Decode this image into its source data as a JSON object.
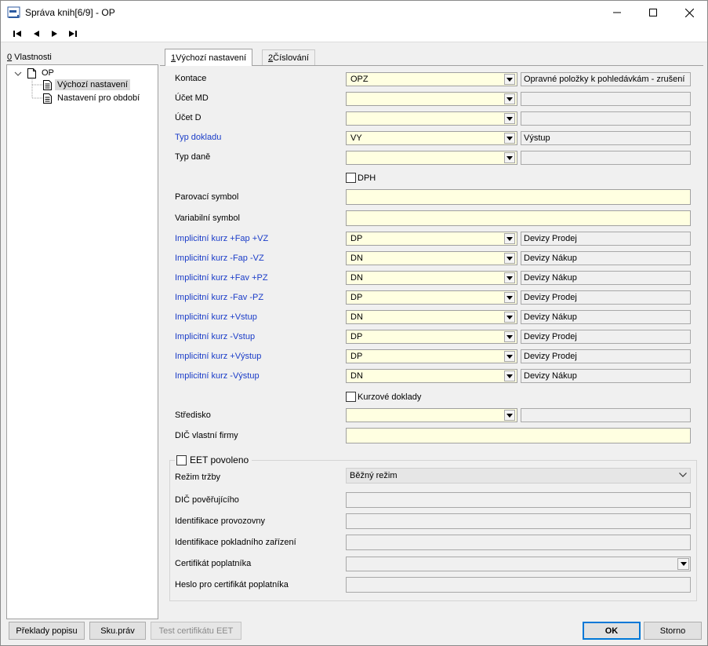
{
  "window": {
    "title": "Správa knih[6/9] - OP",
    "minimize_glyph": "—",
    "maximize_glyph": "☐",
    "close_glyph": "✕"
  },
  "toolbar": {
    "buttons": [
      "first-record-icon",
      "previous-record-icon",
      "next-record-icon",
      "last-record-icon"
    ]
  },
  "tree": {
    "caption_mnemonic": "0",
    "caption_rest": " Vlastnosti",
    "root": "OP",
    "items": [
      "Výchozí nastavení",
      "Nastavení pro období"
    ],
    "selected_index": 0
  },
  "tabs": [
    {
      "mnemonic": "1",
      "label": " Výchozí nastavení",
      "active": true
    },
    {
      "mnemonic": "2",
      "label": " Číslování",
      "active": false
    }
  ],
  "form": {
    "kontace": {
      "label": "Kontace",
      "value": "OPZ",
      "desc": "Opravné položky k pohledávkám - zrušení"
    },
    "ucet_md": {
      "label": "Účet MD",
      "value": "",
      "desc": ""
    },
    "ucet_d": {
      "label": "Účet D",
      "value": "",
      "desc": ""
    },
    "typ_dokladu": {
      "label": "Typ dokladu",
      "value": "VY",
      "desc": "Výstup"
    },
    "typ_dane": {
      "label": "Typ daně",
      "value": "",
      "desc": ""
    },
    "dph_label": "DPH",
    "parovaci_symbol": {
      "label": "Parovací symbol",
      "value": ""
    },
    "variabilni_symbol": {
      "label": "Variabilní symbol",
      "value": ""
    },
    "kurzy": [
      {
        "label": "Implicitní kurz +Fap +VZ",
        "value": "DP",
        "desc": "Devizy Prodej"
      },
      {
        "label": "Implicitní kurz -Fap -VZ",
        "value": "DN",
        "desc": "Devizy Nákup"
      },
      {
        "label": "Implicitní kurz +Fav +PZ",
        "value": "DN",
        "desc": "Devizy Nákup"
      },
      {
        "label": "Implicitní kurz -Fav -PZ",
        "value": "DP",
        "desc": "Devizy Prodej"
      },
      {
        "label": "Implicitní kurz +Vstup",
        "value": "DN",
        "desc": "Devizy Nákup"
      },
      {
        "label": "Implicitní kurz -Vstup",
        "value": "DP",
        "desc": "Devizy Prodej"
      },
      {
        "label": "Implicitní kurz +Výstup",
        "value": "DP",
        "desc": "Devizy Prodej"
      },
      {
        "label": "Implicitní kurz -Výstup",
        "value": "DN",
        "desc": "Devizy Nákup"
      }
    ],
    "kurzove_doklady_label": "Kurzové doklady",
    "stredisko": {
      "label": "Středisko",
      "value": "",
      "desc": ""
    },
    "dic_vlastni_firmy": {
      "label": "DIČ vlastní firmy",
      "value": ""
    }
  },
  "eet": {
    "legend": "EET povoleno",
    "rezim_trzby": {
      "label": "Režim tržby",
      "value": "Běžný režim"
    },
    "dic_poverujiciho": {
      "label": "DIČ pověřujícího",
      "value": ""
    },
    "identifikace_provozovny": {
      "label": "Identifikace provozovny",
      "value": ""
    },
    "identifikace_pokladniho_zarizeni": {
      "label": "Identifikace pokladního zařízení",
      "value": ""
    },
    "certifikat_poplatnika": {
      "label": "Certifikát poplatníka",
      "value": ""
    },
    "heslo_certifikat": {
      "label": "Heslo pro certifikát poplatníka",
      "value": ""
    }
  },
  "buttons": {
    "preklady": "Překlady popisu",
    "sku_prav": "Sku.práv",
    "test_cert": "Test certifikátu EET",
    "ok": "OK",
    "storno": "Storno"
  },
  "colors": {
    "required_field_bg": "#ffffe1",
    "blue_label": "#1a3cc8",
    "primary_button_border": "#0078d7"
  }
}
